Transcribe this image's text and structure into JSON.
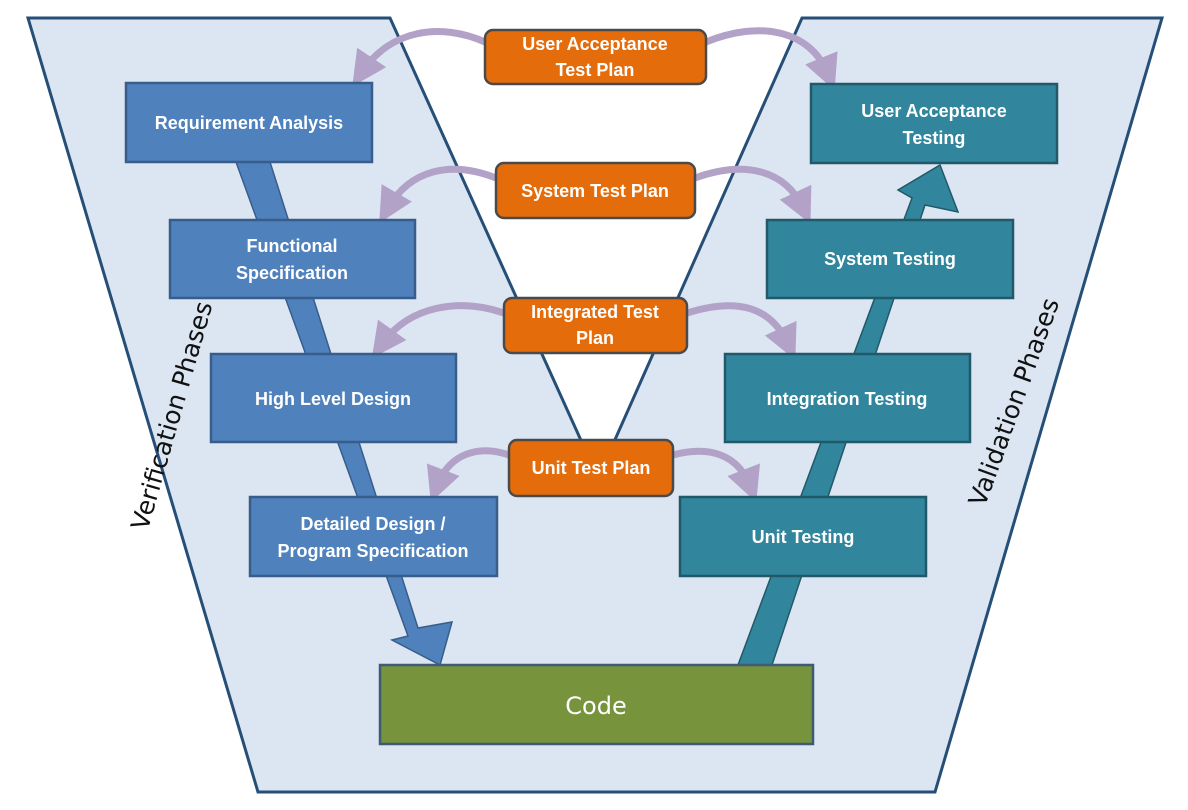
{
  "colors": {
    "background_panel": "#dce6f2",
    "panel_border": "#264f78",
    "verification_box": "#4f81bd",
    "validation_box": "#31859c",
    "test_plan_box": "#e46c0a",
    "code_box": "#77933c",
    "curved_arrow": "#b3a2c7"
  },
  "phases": {
    "verification": "Verification Phases",
    "validation": "Validation Phases"
  },
  "verification_steps": [
    {
      "lines": [
        "Requirement Analysis"
      ]
    },
    {
      "lines": [
        "Functional",
        "Specification"
      ]
    },
    {
      "lines": [
        "High Level Design"
      ]
    },
    {
      "lines": [
        "Detailed Design /",
        "Program Specification"
      ]
    }
  ],
  "validation_steps": [
    {
      "lines": [
        "User Acceptance",
        "Testing"
      ]
    },
    {
      "lines": [
        "System Testing"
      ]
    },
    {
      "lines": [
        "Integration Testing"
      ]
    },
    {
      "lines": [
        "Unit Testing"
      ]
    }
  ],
  "test_plans": [
    {
      "lines": [
        "User Acceptance",
        "Test Plan"
      ]
    },
    {
      "lines": [
        "System Test Plan"
      ]
    },
    {
      "lines": [
        "Integrated Test",
        "Plan"
      ]
    },
    {
      "lines": [
        "Unit Test Plan"
      ]
    }
  ],
  "code": {
    "label": "Code"
  }
}
